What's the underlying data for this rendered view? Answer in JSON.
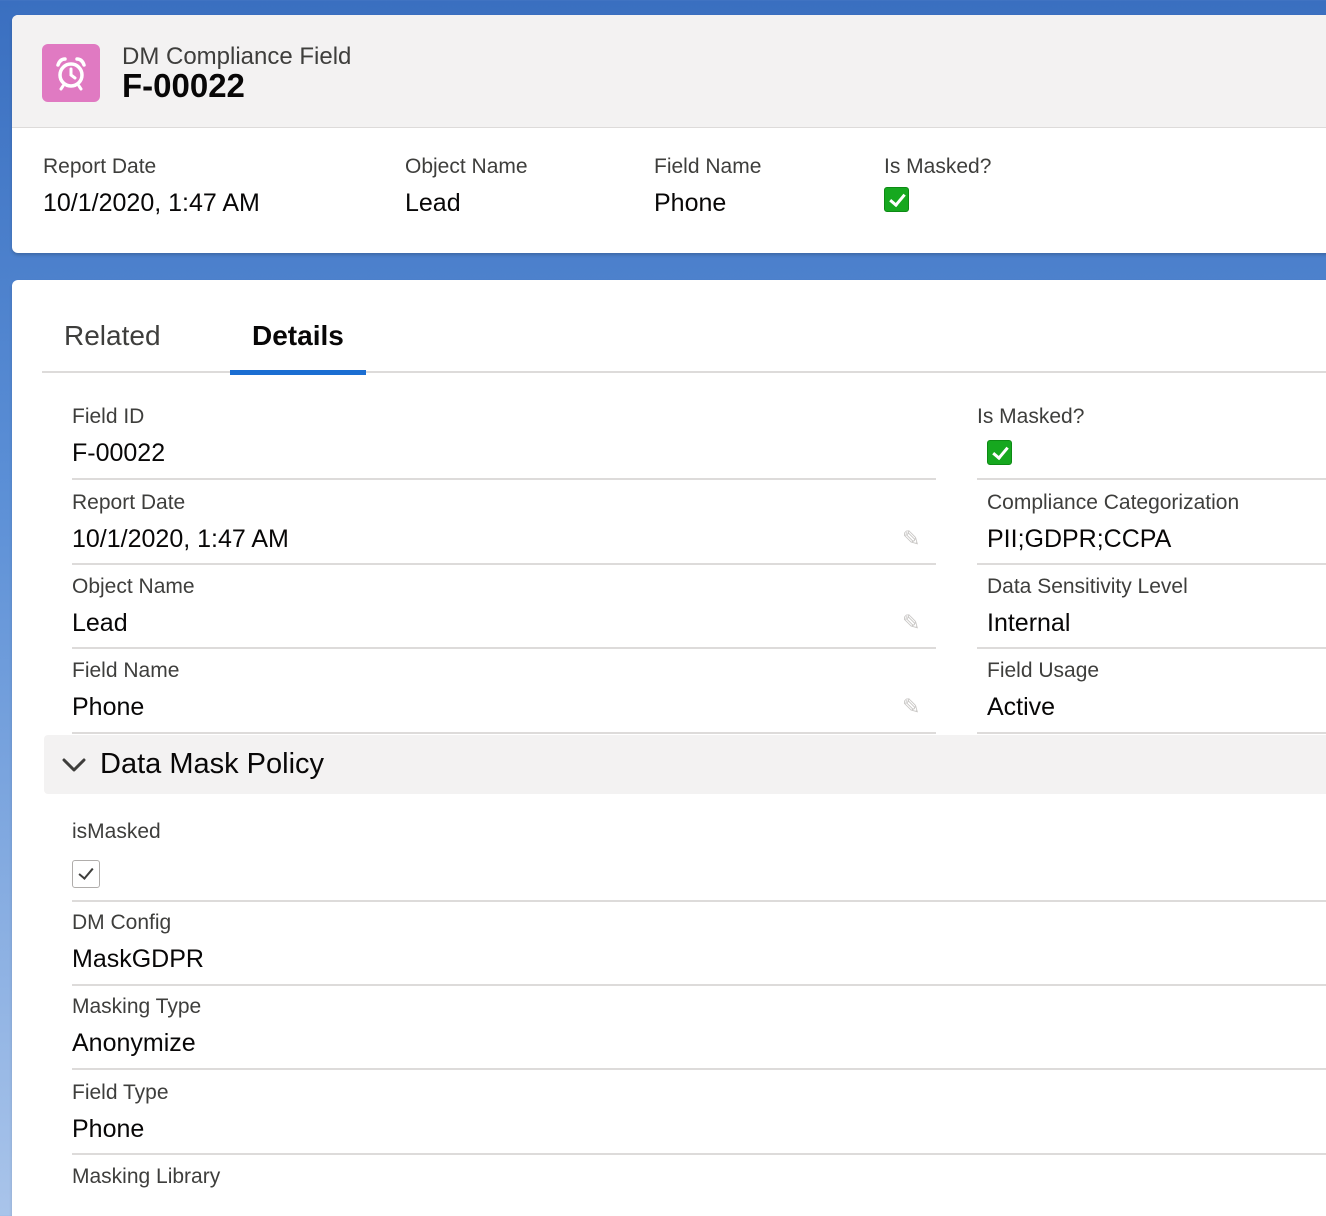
{
  "header": {
    "object_label": "DM Compliance Field",
    "record_title": "F-00022",
    "icon": "alarm-clock-icon",
    "icon_color": "#e07ac2"
  },
  "highlights": [
    {
      "label": "Report Date",
      "value": "10/1/2020, 1:47 AM"
    },
    {
      "label": "Object Name",
      "value": "Lead"
    },
    {
      "label": "Field Name",
      "value": "Phone"
    },
    {
      "label": "Is Masked?",
      "value": "checked",
      "type": "checkbox-green"
    }
  ],
  "tabs": [
    {
      "label": "Related",
      "active": false
    },
    {
      "label": "Details",
      "active": true
    }
  ],
  "details": {
    "left": [
      {
        "label": "Field ID",
        "value": "F-00022",
        "editable": false
      },
      {
        "label": "Report Date",
        "value": "10/1/2020, 1:47 AM",
        "editable": true
      },
      {
        "label": "Object Name",
        "value": "Lead",
        "editable": true
      },
      {
        "label": "Field Name",
        "value": "Phone",
        "editable": true
      }
    ],
    "right": [
      {
        "label": "Is Masked?",
        "value": "checked",
        "type": "checkbox-green"
      },
      {
        "label": "Compliance Categorization",
        "value": "PII;GDPR;CCPA"
      },
      {
        "label": "Data Sensitivity Level",
        "value": "Internal"
      },
      {
        "label": "Field Usage",
        "value": "Active"
      }
    ]
  },
  "section": {
    "title": "Data Mask Policy",
    "expanded": true,
    "fields": [
      {
        "label": "isMasked",
        "value": "checked",
        "type": "checkbox"
      },
      {
        "label": "DM Config",
        "value": "MaskGDPR"
      },
      {
        "label": "Masking Type",
        "value": "Anonymize"
      },
      {
        "label": "Field Type",
        "value": "Phone"
      },
      {
        "label": "Masking Library",
        "value": ""
      }
    ]
  },
  "colors": {
    "tab_active_underline": "#1b6ed2",
    "check_green": "#16a81f"
  }
}
